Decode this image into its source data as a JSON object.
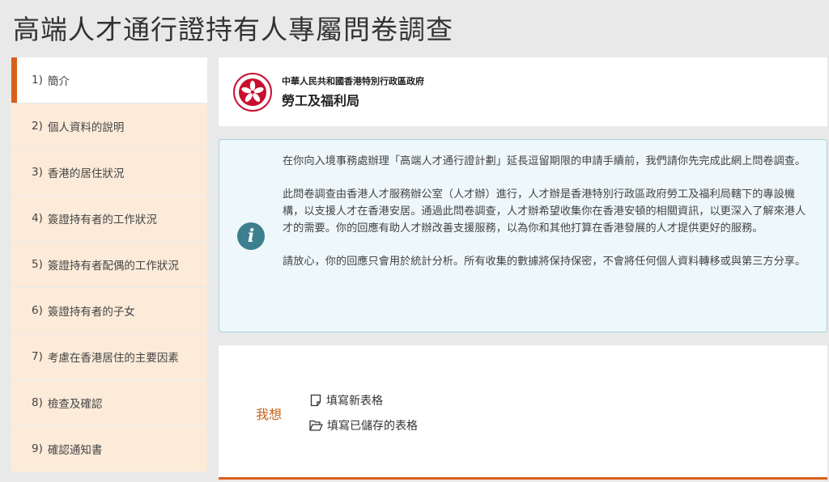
{
  "page": {
    "title": "高端人才通行證持有人專屬問卷調查"
  },
  "sidebar": {
    "steps": [
      {
        "num": "1)",
        "label": "簡介"
      },
      {
        "num": "2)",
        "label": "個人資料的說明"
      },
      {
        "num": "3)",
        "label": "香港的居住狀況"
      },
      {
        "num": "4)",
        "label": "簽證持有者的工作狀況"
      },
      {
        "num": "5)",
        "label": "簽證持有者配偶的工作狀況"
      },
      {
        "num": "6)",
        "label": "簽證持有者的子女"
      },
      {
        "num": "7)",
        "label": "考慮在香港居住的主要因素"
      },
      {
        "num": "8)",
        "label": "檢查及確認"
      },
      {
        "num": "9)",
        "label": "確認通知書"
      }
    ]
  },
  "header": {
    "dept_line1": "中華人民共和國香港特別行政區政府",
    "dept_line2": "勞工及福利局",
    "emblem_icon": "hksar-emblem-icon",
    "emblem_color": "#c8102e"
  },
  "info": {
    "icon": "info-icon",
    "paragraphs": [
      "在你向入境事務處辦理「高端人才通行證計劃」延長逗留期限的申請手續前，我們請你先完成此網上問卷調查。",
      "此問卷調查由香港人才服務辦公室（人才辦）進行，人才辦是香港特別行政區政府勞工及福利局轄下的專設機構，以支援人才在香港安居。通過此問卷調查，人才辦希望收集你在香港安頓的相關資訊，以更深入了解來港人才的需要。你的回應有助人才辦改善支援服務，以為你和其他打算在香港發展的人才提供更好的服務。",
      "請放心，你的回應只會用於統計分析。所有收集的數據將保持保密，不會將任何個人資料轉移或與第三方分享。"
    ]
  },
  "actions": {
    "prefix": "我想",
    "new_form": "填寫新表格",
    "saved_form": "填寫已儲存的表格"
  },
  "colors": {
    "accent": "#d9601a",
    "sidebar_bg": "#fdebd9",
    "info_bg": "#eef8fb",
    "info_border": "#a9d3de"
  }
}
